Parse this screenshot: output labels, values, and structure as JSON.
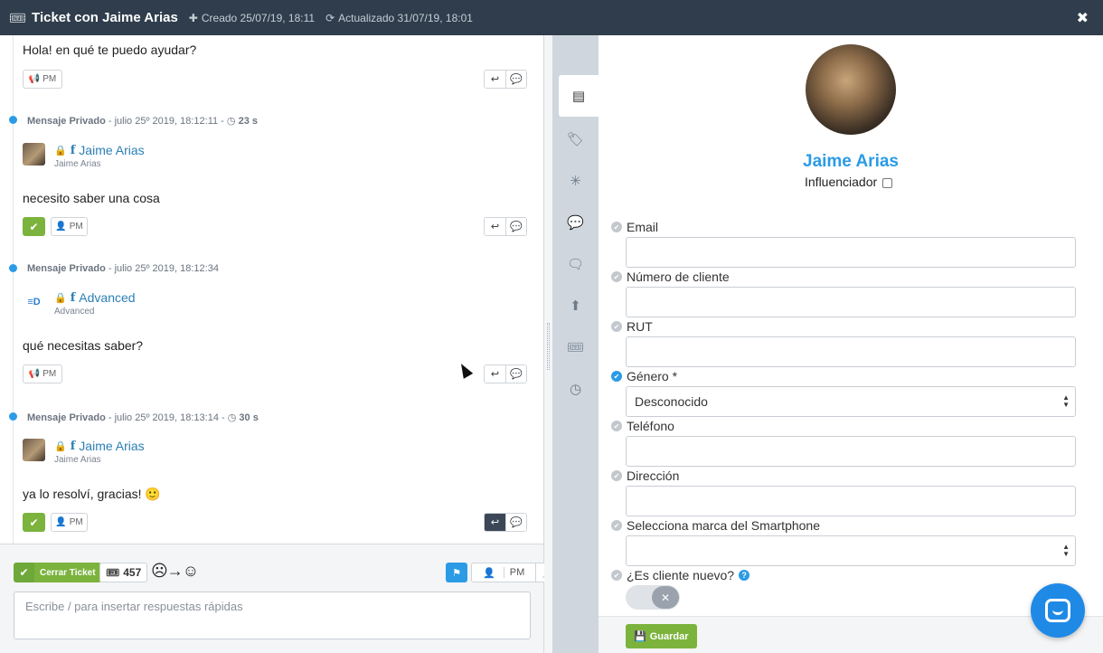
{
  "header": {
    "title": "Ticket con Jaime Arias",
    "created": "Creado 25/07/19, 18:11",
    "updated": "Actualizado 31/07/19, 18:01",
    "close": "✖"
  },
  "messages": {
    "m0": {
      "text": "Hola! en qué te puedo ayudar?",
      "pm": "PM"
    },
    "m1": {
      "kind": "Mensaje Privado",
      "date": "- julio 25º 2019, 18:12:11 -",
      "duration": "23 s",
      "author": "Jaime Arias",
      "author_sub": "Jaime Arias",
      "text": "necesito saber una cosa",
      "pm": "PM"
    },
    "m2": {
      "kind": "Mensaje Privado",
      "date": "- julio 25º 2019, 18:12:34",
      "author": "Advanced",
      "author_sub": "Advanced",
      "text": "qué necesitas saber?",
      "pm": "PM"
    },
    "m3": {
      "kind": "Mensaje Privado",
      "date": "- julio 25º 2019, 18:13:14 -",
      "duration": "30 s",
      "author": "Jaime Arias",
      "author_sub": "Jaime Arias",
      "text": "ya lo resolví, gracias! 🙂",
      "pm": "PM"
    }
  },
  "composer": {
    "close_ticket": "Cerrar Ticket",
    "ticket_number": "457",
    "mood": "☹→☺",
    "pm": "PM",
    "placeholder": "Escribe / para insertar respuestas rápidas"
  },
  "profile": {
    "name": "Jaime Arias",
    "influencer_label": "Influenciador",
    "fields": {
      "email": "Email",
      "client_number": "Número de cliente",
      "rut": "RUT",
      "gender": "Género *",
      "gender_value": "Desconocido",
      "phone": "Teléfono",
      "address": "Dirección",
      "brand": "Selecciona marca del Smartphone",
      "new_client": "¿Es cliente nuevo?"
    },
    "save": "Guardar"
  },
  "icons": [
    "contact-card-icon",
    "tag-icon",
    "network-icon",
    "chat-bubble-icon",
    "conversations-icon",
    "upload-icon",
    "ticket-icon",
    "clock-icon"
  ],
  "colors": {
    "accent": "#2b9be6",
    "success": "#7bb33d",
    "header": "#2f3d4c"
  }
}
